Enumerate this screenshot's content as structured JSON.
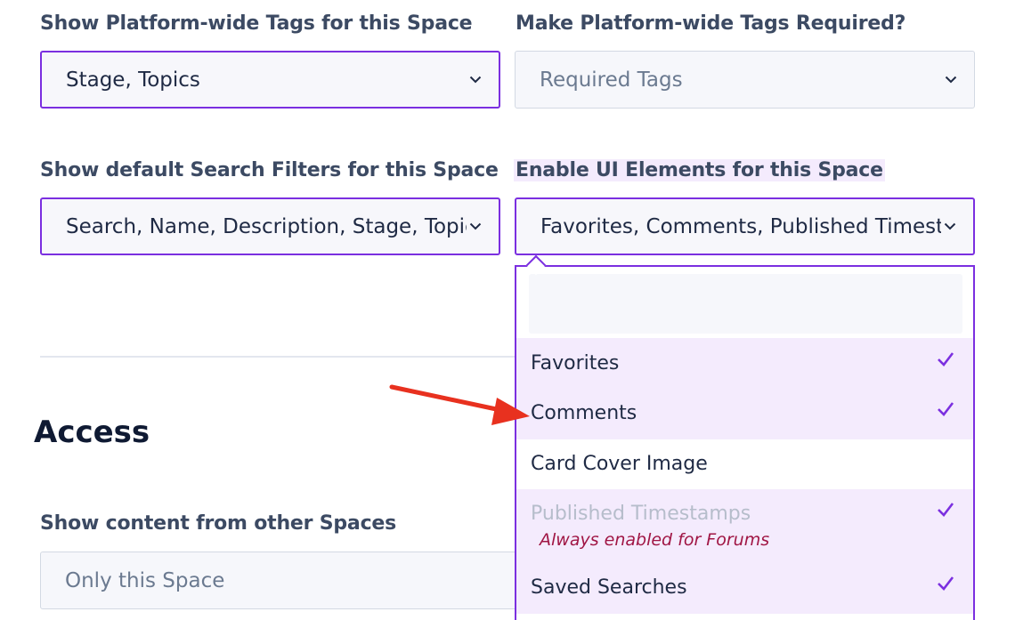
{
  "fields": {
    "platform_tags": {
      "label": "Show Platform-wide Tags for this Space",
      "value": "Stage, Topics"
    },
    "required_tags": {
      "label": "Make Platform-wide Tags Required?",
      "placeholder": "Required Tags"
    },
    "search_filters": {
      "label": "Show default Search Filters for this Space",
      "value": "Search, Name, Description, Stage, Topics, "
    },
    "ui_elements": {
      "label": "Enable UI Elements for this Space",
      "value": "Favorites, Comments, Published Timestamps"
    },
    "other_spaces": {
      "label": "Show content from other Spaces",
      "value": "Only this Space"
    }
  },
  "access": {
    "title": "Access"
  },
  "dropdown": {
    "search_value": "",
    "options": [
      {
        "label": "Favorites",
        "selected": true,
        "disabled": false,
        "note": ""
      },
      {
        "label": "Comments",
        "selected": true,
        "disabled": false,
        "note": ""
      },
      {
        "label": "Card Cover Image",
        "selected": false,
        "disabled": false,
        "note": ""
      },
      {
        "label": "Published Timestamps",
        "selected": true,
        "disabled": true,
        "note": "Always enabled for Forums"
      },
      {
        "label": "Saved Searches",
        "selected": true,
        "disabled": false,
        "note": ""
      }
    ]
  },
  "colors": {
    "accent": "#7b2fe0",
    "selected_bg": "#f4ebfd",
    "annotation_arrow": "#e8311f",
    "note": "#a01544"
  },
  "icons": {
    "select": "chevron-down-icon",
    "option": "checkmark-icon",
    "annotation": "red-arrow"
  }
}
